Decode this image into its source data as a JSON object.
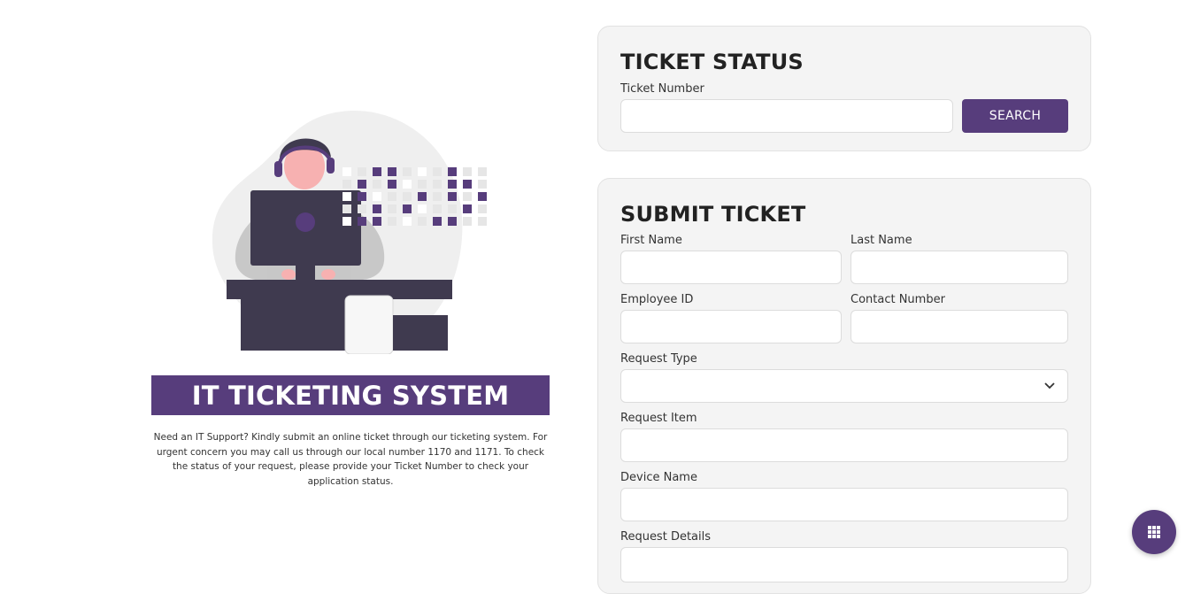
{
  "hero": {
    "title": "IT TICKETING SYSTEM",
    "description": "Need an IT Support? Kindly submit an online ticket through our ticketing system. For urgent concern you may call us through our local number 1170 and 1171. To check the status of your request, please provide your Ticket Number to check your application status."
  },
  "status": {
    "title": "TICKET STATUS",
    "ticket_number_label": "Ticket Number",
    "ticket_number_value": "",
    "search_label": "SEARCH"
  },
  "submit": {
    "title": "SUBMIT TICKET",
    "first_name_label": "First Name",
    "last_name_label": "Last Name",
    "employee_id_label": "Employee ID",
    "contact_number_label": "Contact Number",
    "request_type_label": "Request Type",
    "request_type_value": "",
    "request_item_label": "Request Item",
    "device_name_label": "Device Name",
    "request_details_label": "Request Details"
  },
  "icons": {
    "dropdown": "chevron-down-icon",
    "fab": "grid-icon"
  },
  "colors": {
    "accent": "#573d7c",
    "card_bg": "#f4f4f4"
  }
}
